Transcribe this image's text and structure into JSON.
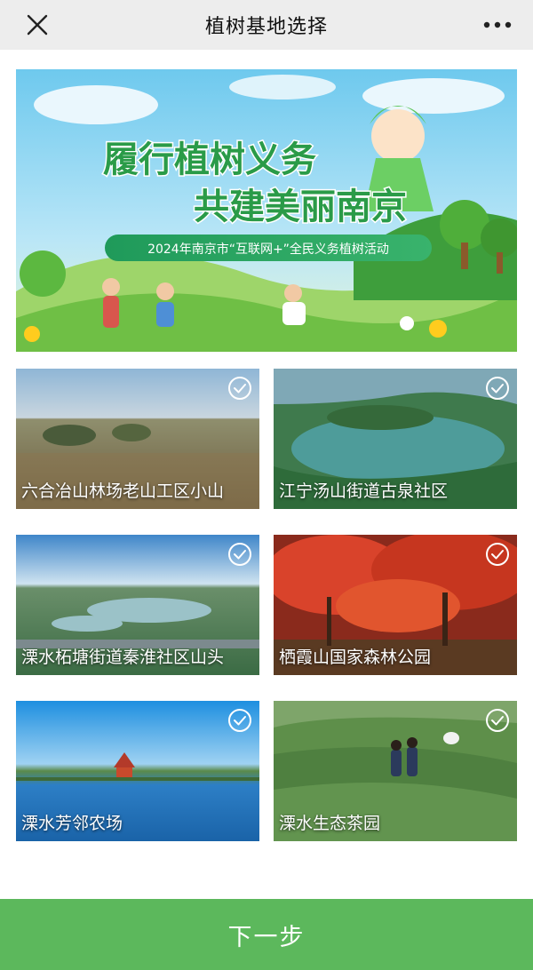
{
  "header": {
    "title": "植树基地选择"
  },
  "banner": {
    "headline_1": "履行植树义务",
    "headline_2": "共建美丽南京",
    "subtitle": "2024年南京市“互联网+”全民义务植树活动"
  },
  "sites": [
    {
      "label": "六合冶山林场老山工区小山",
      "selected": false
    },
    {
      "label": "江宁汤山街道古泉社区",
      "selected": false
    },
    {
      "label": "溧水柘塘街道秦淮社区山头",
      "selected": false
    },
    {
      "label": "栖霞山国家森林公园",
      "selected": false
    },
    {
      "label": "溧水芳邻农场",
      "selected": false
    },
    {
      "label": "溧水生态茶园",
      "selected": false
    }
  ],
  "footer": {
    "next_label": "下一步"
  },
  "colors": {
    "primary": "#5cb85c",
    "topbar": "#ededed"
  },
  "icons": [
    "close-icon",
    "more-icon",
    "check-circle-icon"
  ]
}
